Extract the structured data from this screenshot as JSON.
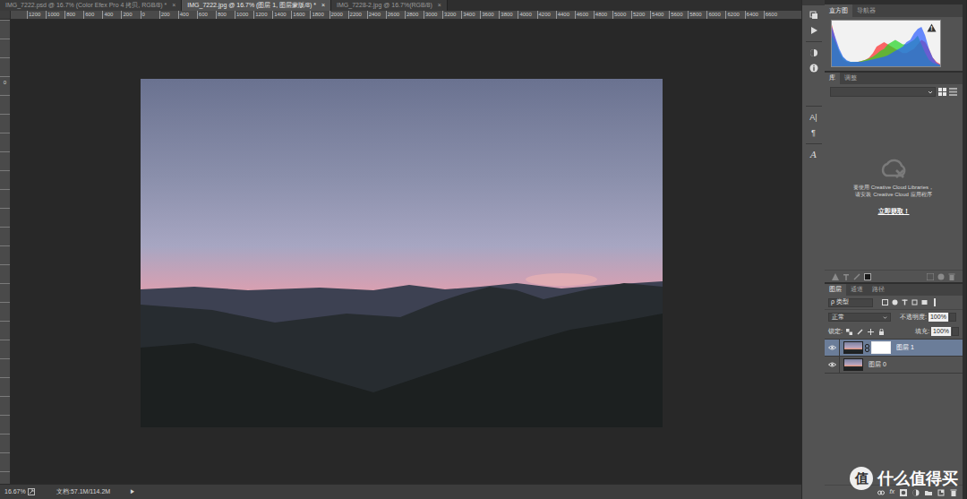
{
  "tabs": [
    {
      "label": "IMG_7222.psd @ 16.7% (Color Efex Pro 4 拷贝, RGB/8) *",
      "close": "×",
      "selected": false
    },
    {
      "label": "IMG_7222.jpg @ 16.7% (图层 1, 图层蒙版/8) *",
      "close": "×",
      "selected": true
    },
    {
      "label": "IMG_7228-2.jpg @ 16.7%(RGB/8)",
      "close": "×",
      "selected": false
    }
  ],
  "ruler": {
    "labels": [
      "1200",
      "1000",
      "800",
      "600",
      "400",
      "200",
      "0",
      "200",
      "400",
      "600",
      "800",
      "1000",
      "1200",
      "1400",
      "1600",
      "1800",
      "2000",
      "2200",
      "2400",
      "2600",
      "2800",
      "3000",
      "3200",
      "3400",
      "3600",
      "3800",
      "4000",
      "4200",
      "4400",
      "4600",
      "4800",
      "5000",
      "5200",
      "5400",
      "5600",
      "5800",
      "6000",
      "6200",
      "6400",
      "6600"
    ],
    "v_label": "0"
  },
  "status_bar": {
    "zoom": "16.67%",
    "document": "文档:57.1M/114.2M",
    "menu_arrow": "▶"
  },
  "dock": {
    "glyphs": [
      "A|",
      "¶",
      "A"
    ]
  },
  "histogram_panel": {
    "tabs": [
      {
        "label": "直方图",
        "selected": true
      },
      {
        "label": "导航器",
        "selected": false
      }
    ],
    "warning": "!",
    "series": [
      {
        "color": "#ff2a2a",
        "values": [
          0.95,
          0.6,
          0.3,
          0.15,
          0.1,
          0.08,
          0.08,
          0.1,
          0.12,
          0.15,
          0.2,
          0.3,
          0.45,
          0.5,
          0.55,
          0.5,
          0.45,
          0.4,
          0.35,
          0.3,
          0.3,
          0.35,
          0.4,
          0.5,
          0.6,
          0.55,
          0.4,
          0.2,
          0.1,
          0.05
        ]
      },
      {
        "color": "#22d422",
        "values": [
          0.7,
          0.55,
          0.35,
          0.2,
          0.12,
          0.1,
          0.1,
          0.1,
          0.12,
          0.15,
          0.18,
          0.22,
          0.28,
          0.35,
          0.4,
          0.5,
          0.55,
          0.6,
          0.55,
          0.5,
          0.5,
          0.55,
          0.6,
          0.7,
          0.5,
          0.3,
          0.15,
          0.08,
          0.05,
          0.03
        ]
      },
      {
        "color": "#2a5bff",
        "values": [
          0.9,
          0.65,
          0.4,
          0.22,
          0.14,
          0.1,
          0.1,
          0.1,
          0.1,
          0.12,
          0.14,
          0.16,
          0.18,
          0.2,
          0.22,
          0.25,
          0.3,
          0.35,
          0.4,
          0.45,
          0.55,
          0.6,
          0.75,
          0.85,
          0.9,
          0.7,
          0.4,
          0.2,
          0.08,
          0.03
        ]
      }
    ]
  },
  "library_panel": {
    "tabs": [
      {
        "label": "库",
        "selected": true
      },
      {
        "label": "调整",
        "selected": false
      }
    ],
    "message": [
      "要使用 Creative Cloud Libraries，",
      "请安装 Creative Cloud 应用程序"
    ],
    "link": "立即获取！"
  },
  "layers_panel": {
    "tabs": [
      {
        "label": "图层",
        "selected": true
      },
      {
        "label": "通道",
        "selected": false
      },
      {
        "label": "路径",
        "selected": false
      }
    ],
    "filter_icon": "ρ",
    "filter": "类型",
    "blend_mode": "正常",
    "opacity_label": "不透明度:",
    "opacity": "100%",
    "lock_label": "锁定:",
    "fill_label": "填充:",
    "fill": "100%",
    "layers": [
      {
        "name": "图层 1",
        "visible": true,
        "selected": true,
        "has_mask": true
      },
      {
        "name": "图层 0",
        "visible": true,
        "selected": false,
        "has_mask": false
      }
    ],
    "footer_fx": "fx"
  },
  "watermark": {
    "logo": "值",
    "text": "什么值得买"
  }
}
